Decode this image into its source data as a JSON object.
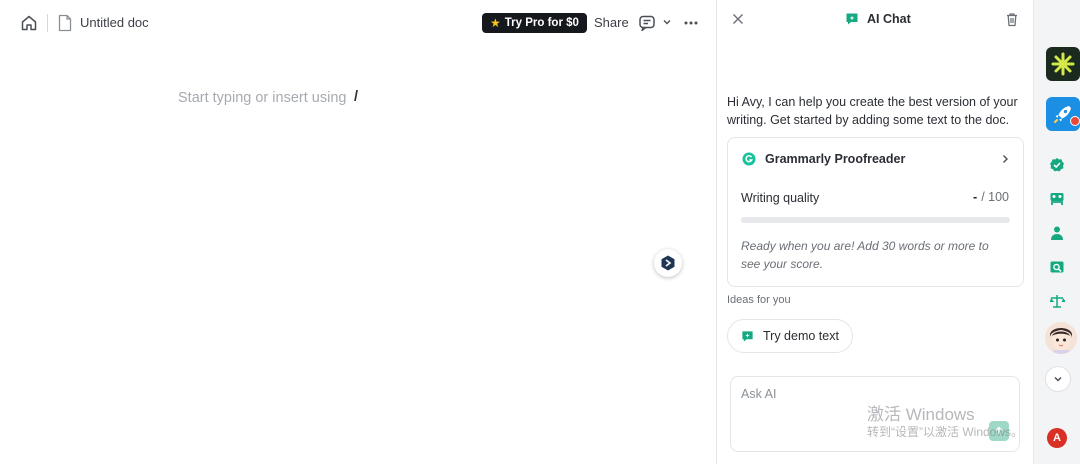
{
  "editor": {
    "doc_title": "Untitled doc",
    "try_pro_label": "Try Pro for $0",
    "share_label": "Share",
    "placeholder": "Start typing or insert using",
    "slash_hint": "/"
  },
  "chat": {
    "title": "AI Chat",
    "greeting": "Hi Avy, I can help you create the best version of your writing. Get started by adding some text to the doc.",
    "proofreader": {
      "title": "Grammarly Proofreader",
      "quality_label": "Writing quality",
      "score_value": "-",
      "score_max": "/ 100",
      "progress_percent": 0,
      "hint": "Ready when you are! Add 30 words or more to see your score."
    },
    "ideas_label": "Ideas for you",
    "demo_label": "Try demo text",
    "ask_placeholder": "Ask AI"
  },
  "watermark": {
    "line1": "激活 Windows",
    "line2": "转到“设置”以激活 Windows。"
  },
  "strip": {
    "user_initial": "A"
  },
  "colors": {
    "brand_green": "#15c39a",
    "dark": "#15181d",
    "rocket_bg": "#1a8fe3",
    "user_badge": "#d93025"
  }
}
